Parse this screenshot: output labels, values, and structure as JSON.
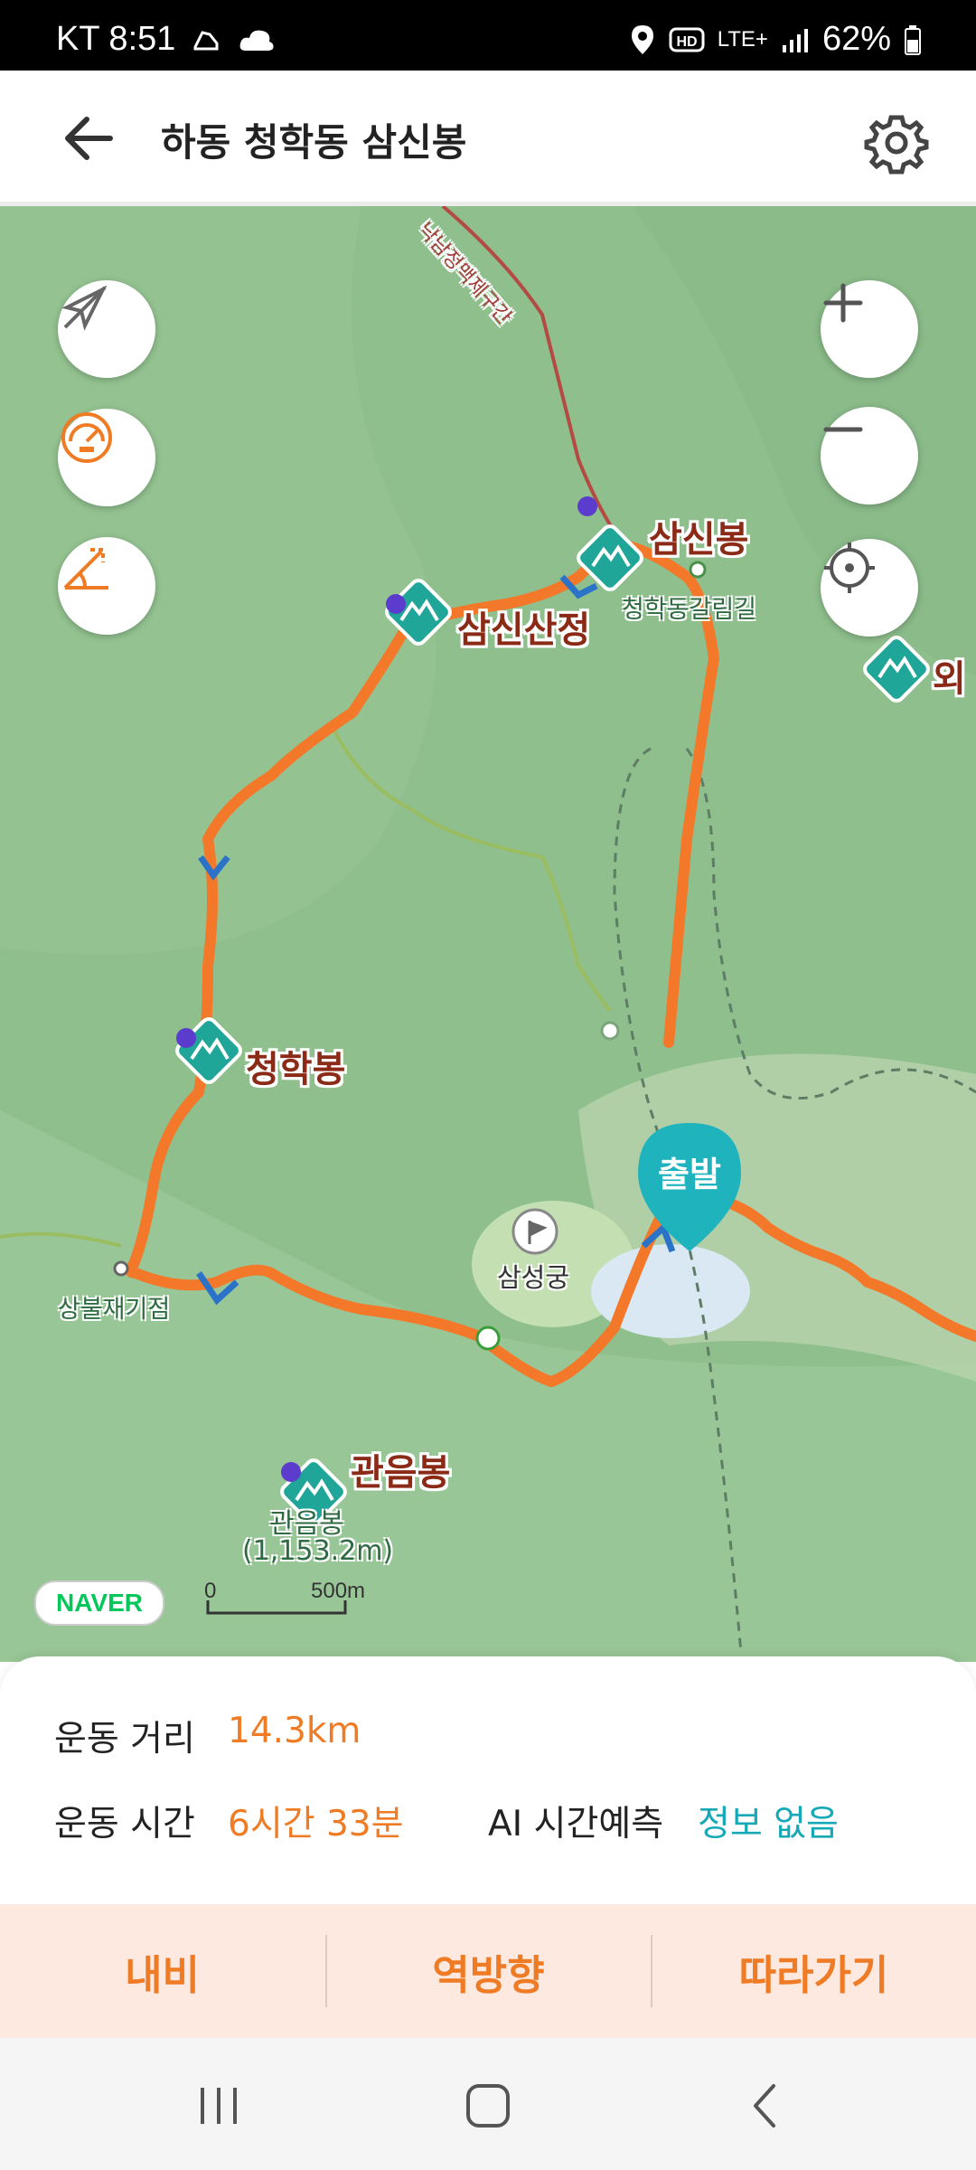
{
  "status_bar": {
    "carrier_time": "KT 8:51",
    "network": "LTE+",
    "battery": "62%",
    "icons": [
      "hiking-shoe-icon",
      "cloud-icon",
      "location-icon",
      "hd-icon",
      "signal-icon",
      "battery-icon"
    ]
  },
  "header": {
    "title": "하동 청학동 삼신봉",
    "back_icon": "arrow-left-icon",
    "settings_icon": "gear-icon"
  },
  "map": {
    "left_controls": [
      "compass-off-icon",
      "speedometer-icon",
      "elevation-icon"
    ],
    "right_controls": [
      "zoom-in-icon",
      "zoom-out-icon",
      "locate-icon"
    ],
    "labels": {
      "peak_samsin": "삼신봉",
      "peak_samsinsanjeong": "삼신산정",
      "peak_cheonghak": "청학봉",
      "peak_gwaneum": "관음봉",
      "peak_right_partial": "외",
      "junction_cheonghakdong": "청학동갈림길",
      "junction_sangbuljae": "상불재기점",
      "temple_samseonggung": "삼성궁",
      "gwaneum_sub": "관음봉",
      "gwaneum_elev": "(1,153.2m)",
      "trail_top": "낙남정맥제구간"
    },
    "start_marker": "출발",
    "naver_logo": "NAVER",
    "scale": {
      "zero": "0",
      "distance": "500m"
    },
    "colors": {
      "route": "#f4782a",
      "terrain": "#8fbf8d",
      "peak_marker": "#20a599",
      "start_marker": "#1fb3bd"
    }
  },
  "stats": {
    "distance_label": "운동 거리",
    "distance_value": "14.3km",
    "time_label": "운동 시간",
    "time_value": "6시간 33분",
    "ai_label": "AI 시간예측",
    "ai_value": "정보 없음"
  },
  "actions": {
    "navi": "내비",
    "reverse": "역방향",
    "follow": "따라가기"
  },
  "nav_bar": [
    "recent-apps-icon",
    "home-icon",
    "back-icon"
  ]
}
